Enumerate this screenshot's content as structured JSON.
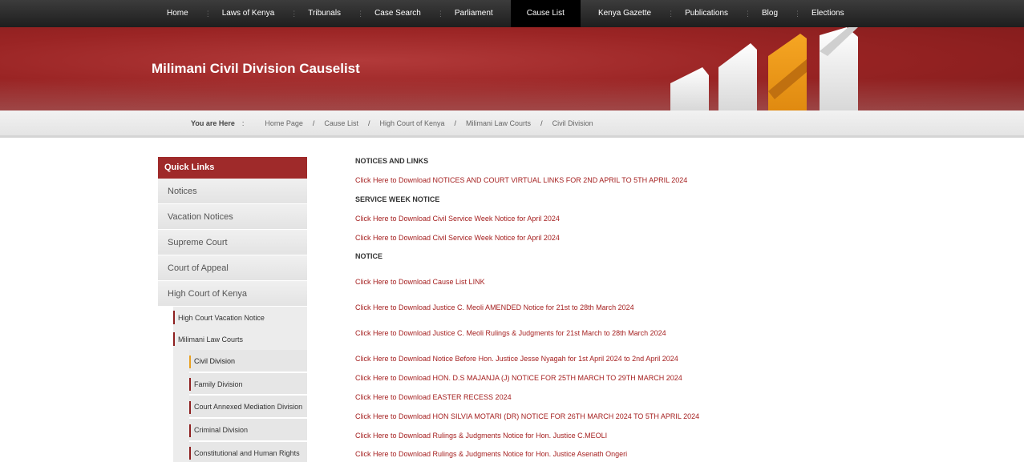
{
  "nav": {
    "items": [
      "Home",
      "Laws of Kenya",
      "Tribunals",
      "Case Search",
      "Parliament",
      "Cause List",
      "Kenya Gazette",
      "Publications",
      "Blog",
      "Elections"
    ],
    "active": "Cause List"
  },
  "banner": {
    "title": "Milimani Civil Division Causelist"
  },
  "breadcrumb": {
    "here": "You are Here",
    "colon": ":",
    "items": [
      "Home Page",
      "Cause List",
      "High Court of Kenya",
      "Milimani Law Courts",
      "Civil Division"
    ]
  },
  "sidebar": {
    "heading": "Quick Links",
    "items": [
      "Notices",
      "Vacation Notices",
      "Supreme Court",
      "Court of Appeal",
      "High Court of Kenya"
    ],
    "sub": [
      "High Court Vacation Notice",
      "Milimani Law Courts"
    ],
    "sub2": [
      "Civil Division",
      "Family Division",
      "Court Annexed Mediation Division",
      "Criminal Division",
      "Constitutional and Human Rights Division"
    ]
  },
  "content": {
    "heading1": "NOTICES AND LINKS",
    "link1": "Click Here to Download NOTICES AND COURT VIRTUAL LINKS FOR 2ND APRIL TO 5TH APRIL 2024",
    "heading2": "SERVICE WEEK NOTICE",
    "link2": "Click Here to Download Civil Service Week Notice for April 2024",
    "link3": "Click Here to Download  Civil Service Week Notice for April 2024",
    "heading3": "NOTICE",
    "links": [
      "Click Here to Download Cause List LINK",
      "Click Here to Download Justice C. Meoli AMENDED Notice for 21st  to 28th  March 2024",
      "Click Here to Download Justice C. Meoli Rulings & Judgments for 21st March to 28th March 2024",
      "Click Here to Download Notice Before Hon. Justice Jesse Nyagah for 1st April 2024 to 2nd April 2024",
      "Click Here to Download HON. D.S MAJANJA (J) NOTICE FOR 25TH MARCH TO 29TH MARCH 2024",
      "Click Here to Download EASTER RECESS 2024",
      "Click Here to Download HON SILVIA MOTARI (DR) NOTICE FOR 26TH MARCH 2024 TO 5TH APRIL 2024",
      "Click Here to Download Rulings & Judgments Notice for Hon. Justice C.MEOLI",
      "Click Here to Download Rulings & Judgments Notice for Hon. Justice Asenath Ongeri"
    ]
  }
}
